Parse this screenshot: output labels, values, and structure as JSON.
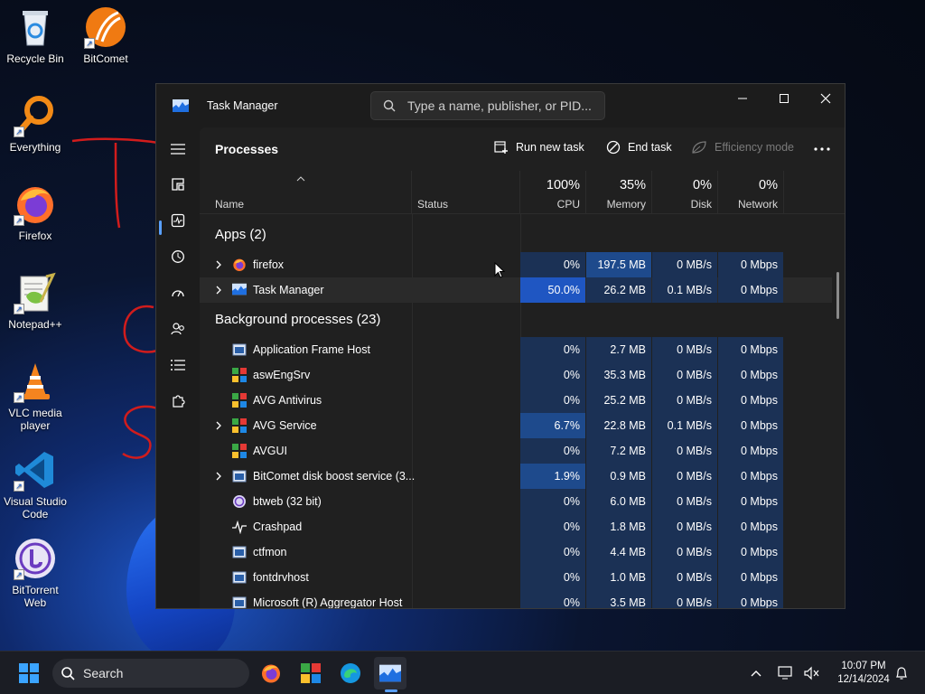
{
  "desktop": {
    "icons": [
      {
        "label": "Recycle Bin"
      },
      {
        "label": "BitComet"
      },
      {
        "label": "Everything"
      },
      {
        "label": "Firefox"
      },
      {
        "label": "Notepad++"
      },
      {
        "label": "VLC media player"
      },
      {
        "label": "Visual Studio Code"
      },
      {
        "label": "BitTorrent Web"
      }
    ]
  },
  "window": {
    "title": "Task Manager",
    "search_placeholder": "Type a name, publisher, or PID...",
    "page_title": "Processes",
    "toolbar": {
      "run_new_task": "Run new task",
      "end_task": "End task",
      "efficiency_mode": "Efficiency mode"
    },
    "columns": {
      "name": "Name",
      "status": "Status",
      "cpu_pct": "100%",
      "cpu": "CPU",
      "memory_pct": "35%",
      "memory": "Memory",
      "disk_pct": "0%",
      "disk": "Disk",
      "network_pct": "0%",
      "network": "Network"
    },
    "sections": {
      "apps": "Apps (2)",
      "background": "Background processes (23)"
    },
    "apps": [
      {
        "name": "firefox",
        "cpu": "0%",
        "memory": "197.5 MB",
        "disk": "0 MB/s",
        "network": "0 Mbps"
      },
      {
        "name": "Task Manager",
        "cpu": "50.0%",
        "memory": "26.2 MB",
        "disk": "0.1 MB/s",
        "network": "0 Mbps"
      }
    ],
    "background": [
      {
        "name": "Application Frame Host",
        "cpu": "0%",
        "memory": "2.7 MB",
        "disk": "0 MB/s",
        "network": "0 Mbps"
      },
      {
        "name": "aswEngSrv",
        "cpu": "0%",
        "memory": "35.3 MB",
        "disk": "0 MB/s",
        "network": "0 Mbps"
      },
      {
        "name": "AVG Antivirus",
        "cpu": "0%",
        "memory": "25.2 MB",
        "disk": "0 MB/s",
        "network": "0 Mbps"
      },
      {
        "name": "AVG Service",
        "cpu": "6.7%",
        "memory": "22.8 MB",
        "disk": "0.1 MB/s",
        "network": "0 Mbps"
      },
      {
        "name": "AVGUI",
        "cpu": "0%",
        "memory": "7.2 MB",
        "disk": "0 MB/s",
        "network": "0 Mbps"
      },
      {
        "name": "BitComet disk boost service (3...",
        "cpu": "1.9%",
        "memory": "0.9 MB",
        "disk": "0 MB/s",
        "network": "0 Mbps"
      },
      {
        "name": "btweb (32 bit)",
        "cpu": "0%",
        "memory": "6.0 MB",
        "disk": "0 MB/s",
        "network": "0 Mbps"
      },
      {
        "name": "Crashpad",
        "cpu": "0%",
        "memory": "1.8 MB",
        "disk": "0 MB/s",
        "network": "0 Mbps"
      },
      {
        "name": "ctfmon",
        "cpu": "0%",
        "memory": "4.4 MB",
        "disk": "0 MB/s",
        "network": "0 Mbps"
      },
      {
        "name": "fontdrvhost",
        "cpu": "0%",
        "memory": "1.0 MB",
        "disk": "0 MB/s",
        "network": "0 Mbps"
      },
      {
        "name": "Microsoft (R) Aggregator Host",
        "cpu": "0%",
        "memory": "3.5 MB",
        "disk": "0 MB/s",
        "network": "0 Mbps"
      }
    ]
  },
  "taskbar": {
    "search_label": "Search",
    "time": "10:07 PM",
    "date": "12/14/2024"
  },
  "colors": {
    "cell_light": "#1b3155",
    "cell_mid": "#1e4a8c",
    "cell_high": "#1f56c2",
    "accent": "#5aa0ff"
  }
}
